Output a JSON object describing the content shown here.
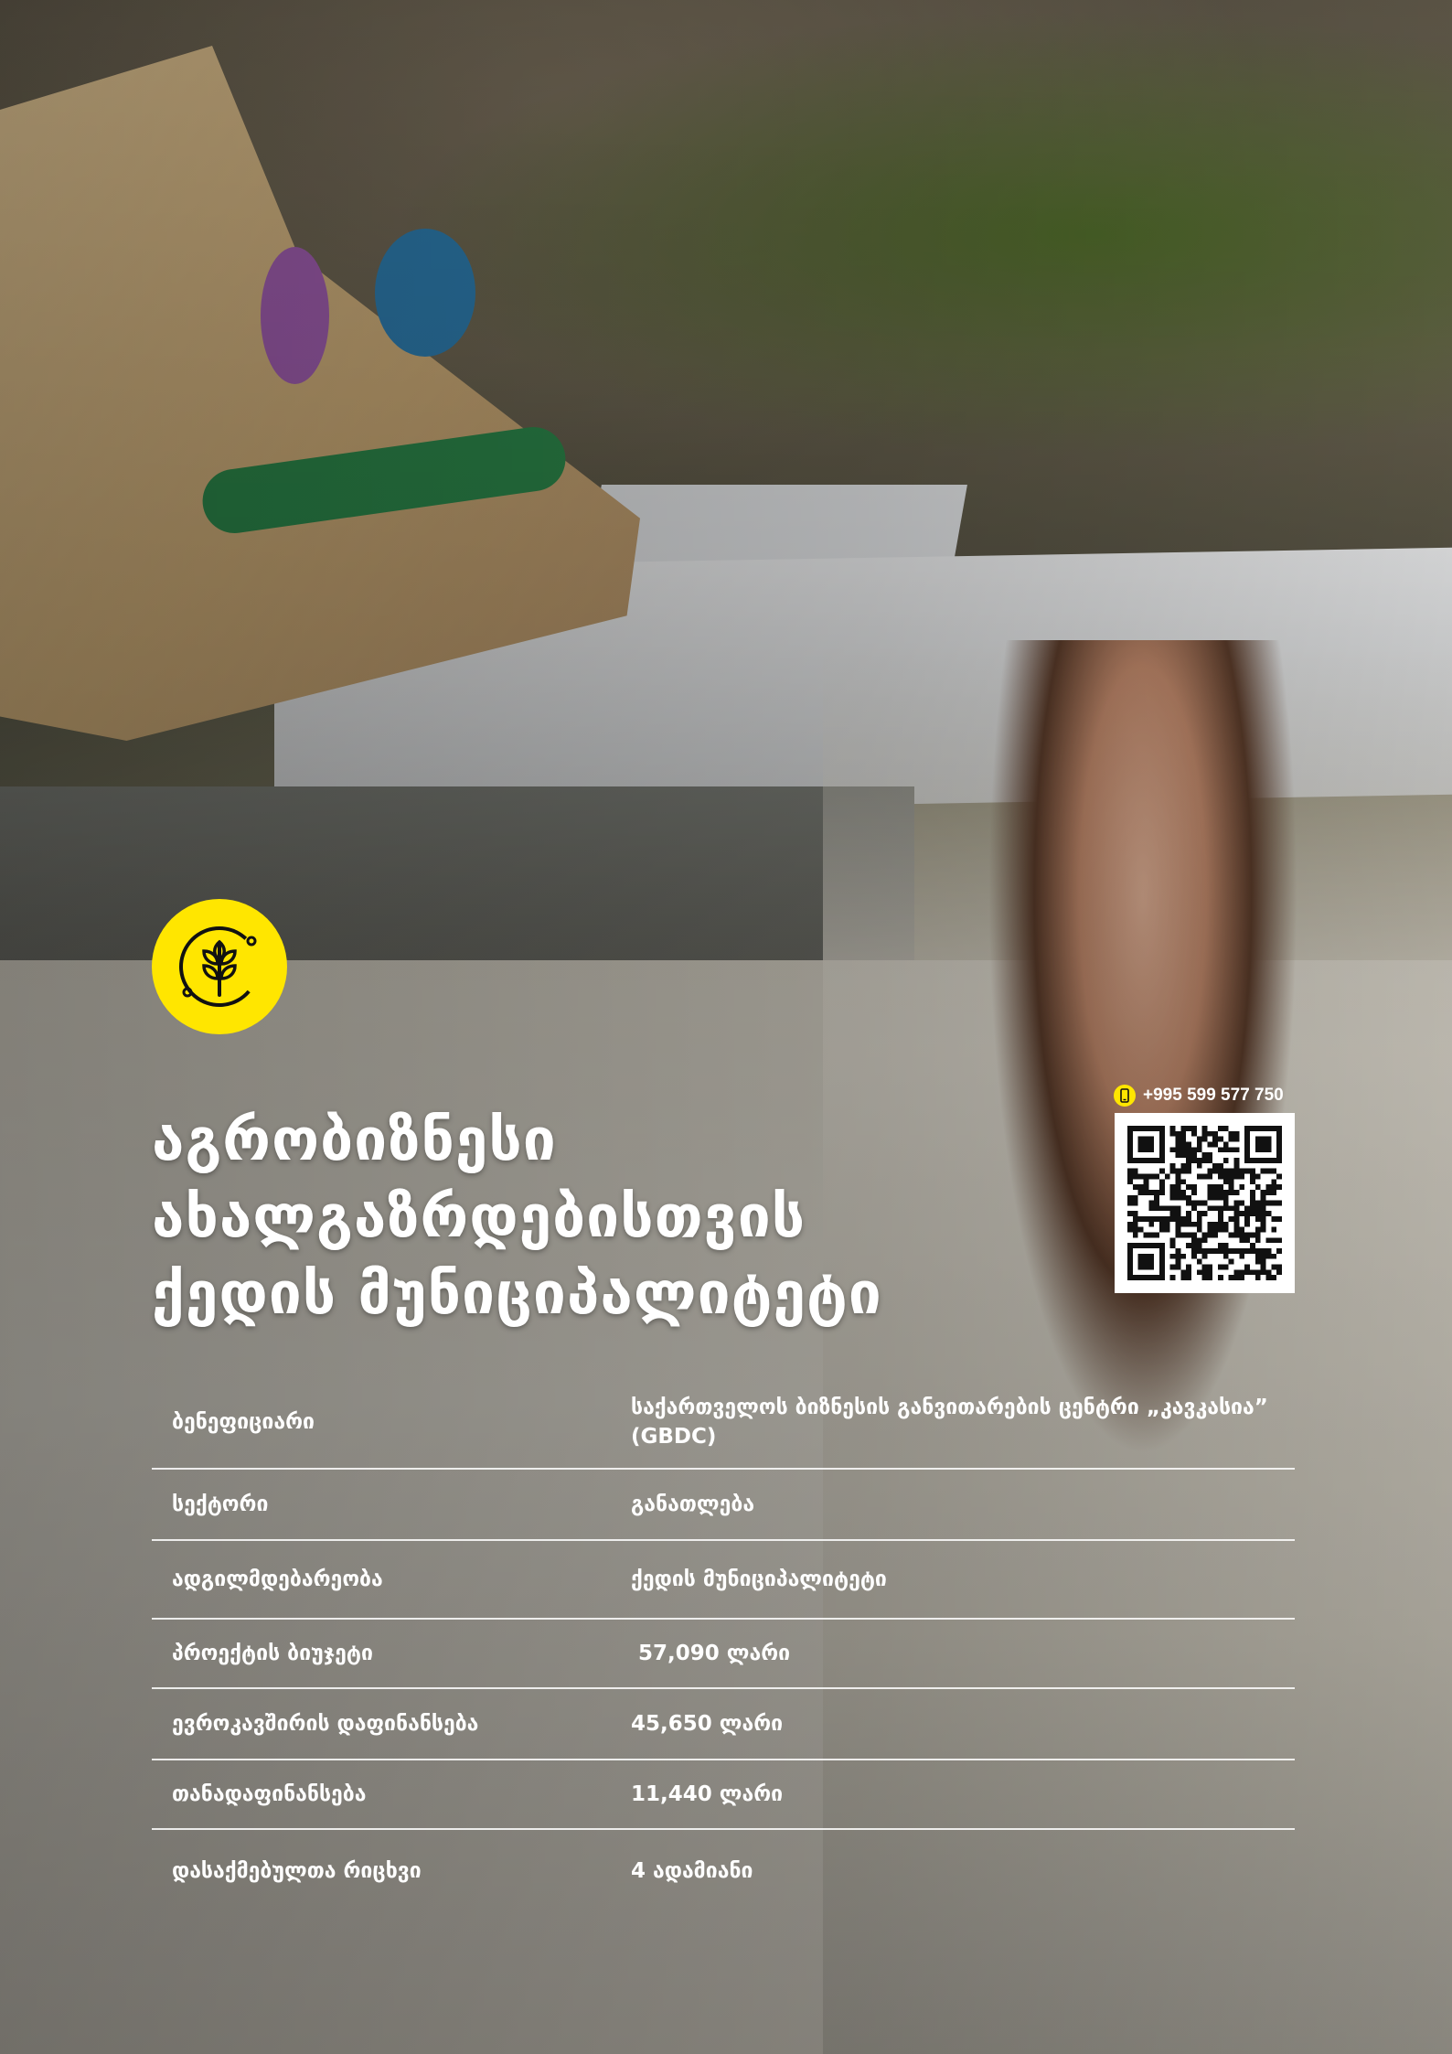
{
  "accent_color": "#ffe600",
  "logo": {
    "icon": "wheat-icon"
  },
  "title": {
    "line1": "აგრობიზნესი",
    "line2": "ახალგაზრდებისთვის",
    "line3": "ქედის მუნიციპალიტეტი"
  },
  "contact": {
    "phone_icon": "mobile-phone-icon",
    "phone": "+995 599 577 750",
    "qr_icon": "qr-code-icon"
  },
  "info_table": [
    {
      "label": "ბენეფიციარი",
      "value": "საქართველოს ბიზნესის განვითარების ცენტრი „კავკასია” (GBDC)"
    },
    {
      "label": "სექტორი",
      "value": "განათლება"
    },
    {
      "label": "ადგილმდებარეობა",
      "value": "ქედის მუნიციპალიტეტი"
    },
    {
      "label": "პროექტის ბიუჯეტი",
      "value": " 57,090 ლარი"
    },
    {
      "label": "ევროკავშირის დაფინანსება",
      "value": "45,650 ლარი"
    },
    {
      "label": "თანადაფინანსება",
      "value": "11,440 ლარი"
    },
    {
      "label": "დასაქმებულთა რიცხვი",
      "value": "4 ადამიანი"
    }
  ]
}
